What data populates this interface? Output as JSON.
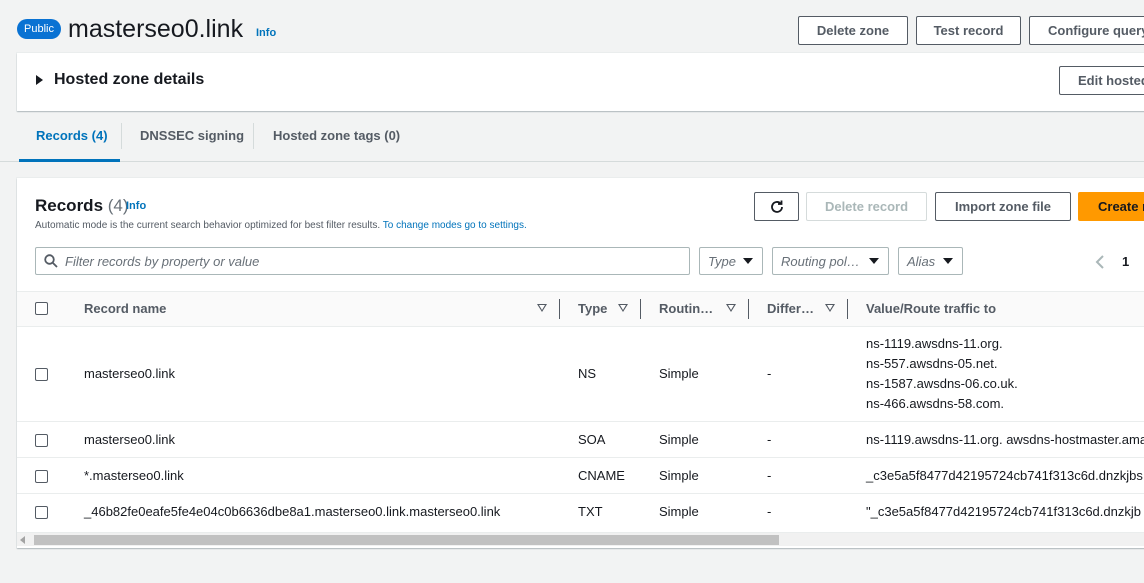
{
  "header": {
    "badge": "Public",
    "zone_name": "masterseo0.link",
    "info": "Info",
    "buttons": {
      "delete_zone": "Delete zone",
      "test_record": "Test record",
      "configure_query": "Configure query"
    }
  },
  "details": {
    "title": "Hosted zone details",
    "edit_button": "Edit hosted"
  },
  "tabs": [
    {
      "label": "Records (4)",
      "active": true
    },
    {
      "label": "DNSSEC signing",
      "active": false
    },
    {
      "label": "Hosted zone tags (0)",
      "active": false
    }
  ],
  "records": {
    "title": "Records",
    "count": "(4)",
    "info": "Info",
    "description": "Automatic mode is the current search behavior optimized for best filter results.",
    "settings_link": "To change modes go to settings.",
    "buttons": {
      "delete": "Delete record",
      "import": "Import zone file",
      "create": "Create r"
    },
    "search_placeholder": "Filter records by property or value",
    "filters": {
      "type": "Type",
      "routing": "Routing pol…",
      "alias": "Alias"
    },
    "page": "1",
    "columns": [
      "Record name",
      "Type",
      "Routin…",
      "Differ…",
      "Value/Route traffic to"
    ],
    "rows": [
      {
        "name": "masterseo0.link",
        "type": "NS",
        "routing": "Simple",
        "differ": "-",
        "values": [
          "ns-1119.awsdns-11.org.",
          "ns-557.awsdns-05.net.",
          "ns-1587.awsdns-06.co.uk.",
          "ns-466.awsdns-58.com."
        ]
      },
      {
        "name": "masterseo0.link",
        "type": "SOA",
        "routing": "Simple",
        "differ": "-",
        "values": [
          "ns-1119.awsdns-11.org. awsdns-hostmaster.ama"
        ]
      },
      {
        "name": "*.masterseo0.link",
        "type": "CNAME",
        "routing": "Simple",
        "differ": "-",
        "values": [
          "_c3e5a5f8477d42195724cb741f313c6d.dnzkjbs"
        ]
      },
      {
        "name": "_46b82fe0eafe5fe4e04c0b6636dbe8a1.masterseo0.link.masterseo0.link",
        "type": "TXT",
        "routing": "Simple",
        "differ": "-",
        "values": [
          "\"_c3e5a5f8477d42195724cb741f313c6d.dnzkjb"
        ]
      }
    ]
  },
  "colors": {
    "accent": "#0073bb",
    "primary_button": "#ff9900",
    "badge": "#0972d3"
  }
}
